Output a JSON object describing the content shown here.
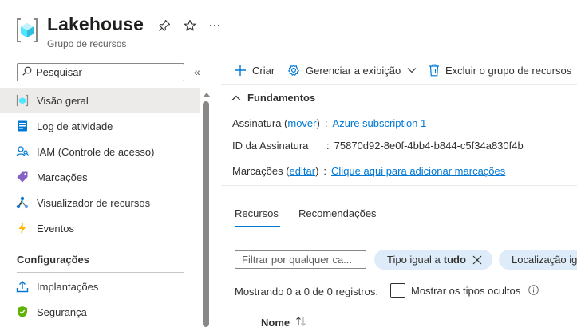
{
  "header": {
    "title": "Lakehouse",
    "subtitle": "Grupo de recursos",
    "icons": [
      "resource-group-icon",
      "pin-icon",
      "star-icon",
      "more-icon"
    ]
  },
  "sidebar": {
    "search_placeholder": "Pesquisar",
    "items": [
      {
        "label": "Visão geral",
        "icon": "overview-icon",
        "active": true
      },
      {
        "label": "Log de atividade",
        "icon": "activity-log-icon"
      },
      {
        "label": "IAM (Controle de acesso)",
        "icon": "iam-icon"
      },
      {
        "label": "Marcações",
        "icon": "tag-icon"
      },
      {
        "label": "Visualizador de recursos",
        "icon": "resource-visualizer-icon"
      },
      {
        "label": "Eventos",
        "icon": "lightning-icon"
      }
    ],
    "section_title": "Configurações",
    "section_items": [
      {
        "label": "Implantações",
        "icon": "deployments-icon"
      },
      {
        "label": "Segurança",
        "icon": "security-shield-icon"
      }
    ]
  },
  "commands": {
    "create": "Criar",
    "manage_view": "Gerenciar a exibição",
    "delete_group": "Excluir o grupo de recursos"
  },
  "essentials": {
    "title": "Fundamentos",
    "subscription_label": "Assinatura",
    "move_link": "mover",
    "subscription_value": "Azure subscription 1",
    "subscription_id_label": "ID da Assinatura",
    "subscription_id": "75870d92-8e0f-4bb4-b844-c5f34a830f4b",
    "tags_label": "Marcações",
    "edit_link": "editar",
    "add_tags_link": "Clique aqui para adicionar marcações"
  },
  "tabs": [
    "Recursos",
    "Recomendações"
  ],
  "filters": {
    "placeholder": "Filtrar por qualquer ca...",
    "type_pill_prefix": "Tipo igual a",
    "type_pill_value": "tudo",
    "location_pill": "Localização igual a tudo"
  },
  "records": {
    "text": "Mostrando 0 a 0 de 0 registros.",
    "show_hidden_label": "Mostrar os tipos ocultos"
  },
  "table": {
    "columns": [
      "Nome"
    ]
  },
  "colors": {
    "accent": "#0078d4",
    "active_nav_bg": "#edebe9",
    "pill_bg": "#deecf9"
  }
}
